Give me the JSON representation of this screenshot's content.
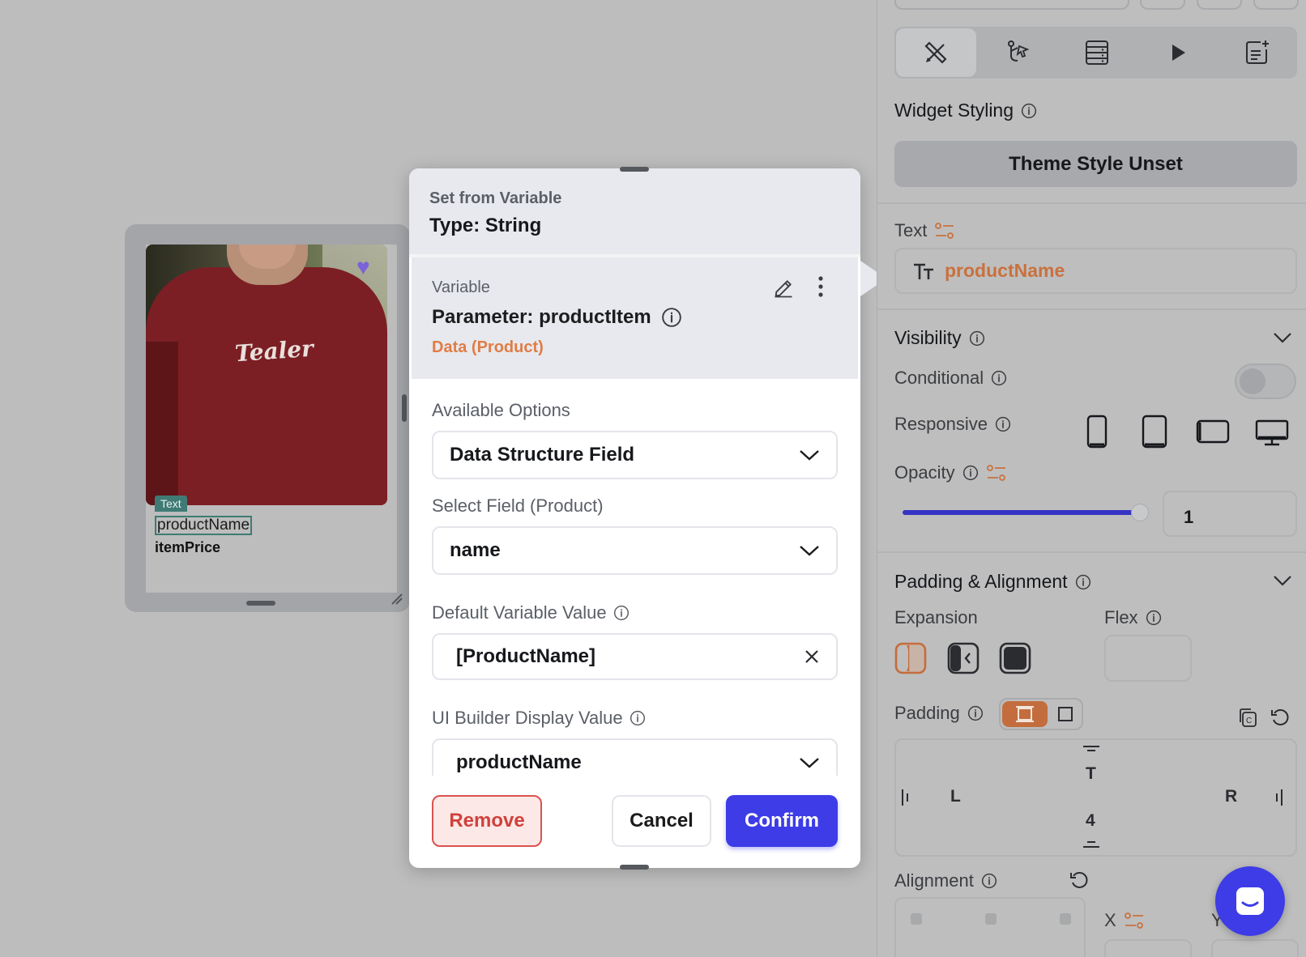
{
  "canvas": {
    "card": {
      "tag": "Text",
      "product_name": "productName",
      "item_price": "itemPrice",
      "shirt_logo": "Tealer"
    }
  },
  "modal": {
    "subtitle": "Set from Variable",
    "title": "Type: String",
    "variable": {
      "label": "Variable",
      "name": "Parameter: productItem",
      "type": "Data (Product)"
    },
    "available_options": {
      "label": "Available Options",
      "value": "Data Structure Field"
    },
    "select_field": {
      "label": "Select Field (Product)",
      "value": "name"
    },
    "default_value": {
      "label": "Default Variable Value",
      "value": "[ProductName]"
    },
    "ui_builder": {
      "label": "UI Builder Display Value",
      "value": "productName"
    },
    "buttons": {
      "remove": "Remove",
      "cancel": "Cancel",
      "confirm": "Confirm"
    }
  },
  "panel": {
    "toolbar": [
      "design-tools-icon",
      "actions-flow-icon",
      "backend-query-icon",
      "play-icon",
      "notes-add-icon"
    ],
    "widget_styling": "Widget Styling",
    "theme_style": "Theme Style Unset",
    "text_label": "Text",
    "text_value": "productName",
    "visibility": "Visibility",
    "conditional": "Conditional",
    "responsive": "Responsive",
    "opacity": "Opacity",
    "opacity_value": "1",
    "opacity_level": 1,
    "padding_alignment": "Padding & Alignment",
    "expansion": "Expansion",
    "flex": "Flex",
    "padding": "Padding",
    "pad_T": "T",
    "pad_L": "L",
    "pad_R": "R",
    "pad_B_value": "4",
    "alignment": "Alignment",
    "x_label": "X",
    "y_label": "Y"
  },
  "colors": {
    "accent": "#3d3ce6",
    "orange": "#e07c45",
    "danger": "#d0413c",
    "tag_green": "#3f7b74"
  }
}
